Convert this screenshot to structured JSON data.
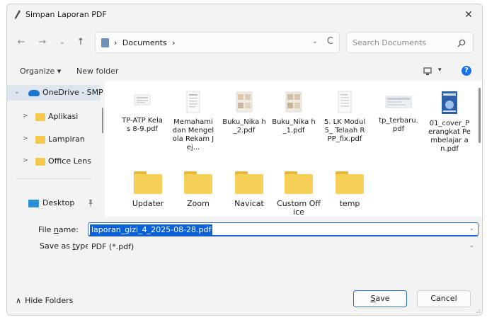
{
  "window": {
    "title": "Simpan Laporan PDF",
    "close": "✕"
  },
  "nav": {
    "back": "←",
    "forward": "→",
    "recent": "⌄",
    "up": "↑",
    "breadcrumb_sep1": "›",
    "breadcrumb": "Documents",
    "breadcrumb_sep2": "›",
    "address_dropdown": "⌄",
    "refresh": "C",
    "search_placeholder": "Search Documents"
  },
  "commands": {
    "organize": "Organize ▾",
    "new_folder": "New folder",
    "view": "▾",
    "help": "?"
  },
  "sidebar": {
    "items": [
      {
        "label": "OneDrive - SMP",
        "icon": "cloud-icon",
        "chevron": "⌄"
      },
      {
        "label": "Aplikasi",
        "icon": "folder-icon",
        "chevron": ">"
      },
      {
        "label": "Lampiran",
        "icon": "folder-icon",
        "chevron": ">"
      },
      {
        "label": "Office Lens",
        "icon": "folder-icon",
        "chevron": ">"
      },
      {
        "label": "Desktop",
        "icon": "desktop-icon",
        "pin": "📌"
      }
    ]
  },
  "files": [
    {
      "name": "TP-ATP Kelas 8-9.pdf",
      "type": "pdf"
    },
    {
      "name": "Memahami dan Mengelola Rekam Jej...",
      "type": "pdf"
    },
    {
      "name": "Buku_Nika h_2.pdf",
      "type": "pdf"
    },
    {
      "name": "Buku_Nika h_1.pdf",
      "type": "pdf"
    },
    {
      "name": "5. LK Modul 5_ Telaah RPP_fix.pdf",
      "type": "pdf"
    },
    {
      "name": "tp_terbaru. pdf",
      "type": "pdf"
    },
    {
      "name": "01_cover_P erangkat Pembelajar an.pdf",
      "type": "pdf"
    }
  ],
  "folders": [
    {
      "name": "Updater"
    },
    {
      "name": "Zoom"
    },
    {
      "name": "Navicat"
    },
    {
      "name": "Custom Office"
    },
    {
      "name": "temp"
    }
  ],
  "form": {
    "filename_label_pre": "File ",
    "filename_label_ul": "n",
    "filename_label_post": "ame:",
    "filename_value": "laporan_gizi_4_2025-08-28.pdf",
    "savetype_label_pre": "Save as ",
    "savetype_label_ul": "t",
    "savetype_label_post": "ype:",
    "savetype_value": "PDF (*.pdf)",
    "dropdown": "⌄"
  },
  "footer": {
    "hide_folders": "Hide Folders",
    "hide_chevron": "∧",
    "save_ul": "S",
    "save_rest": "ave",
    "cancel": "Cancel"
  },
  "colors": {
    "accent": "#0b61d8",
    "folder": "#f6cf57",
    "selection": "#dde5ef"
  }
}
